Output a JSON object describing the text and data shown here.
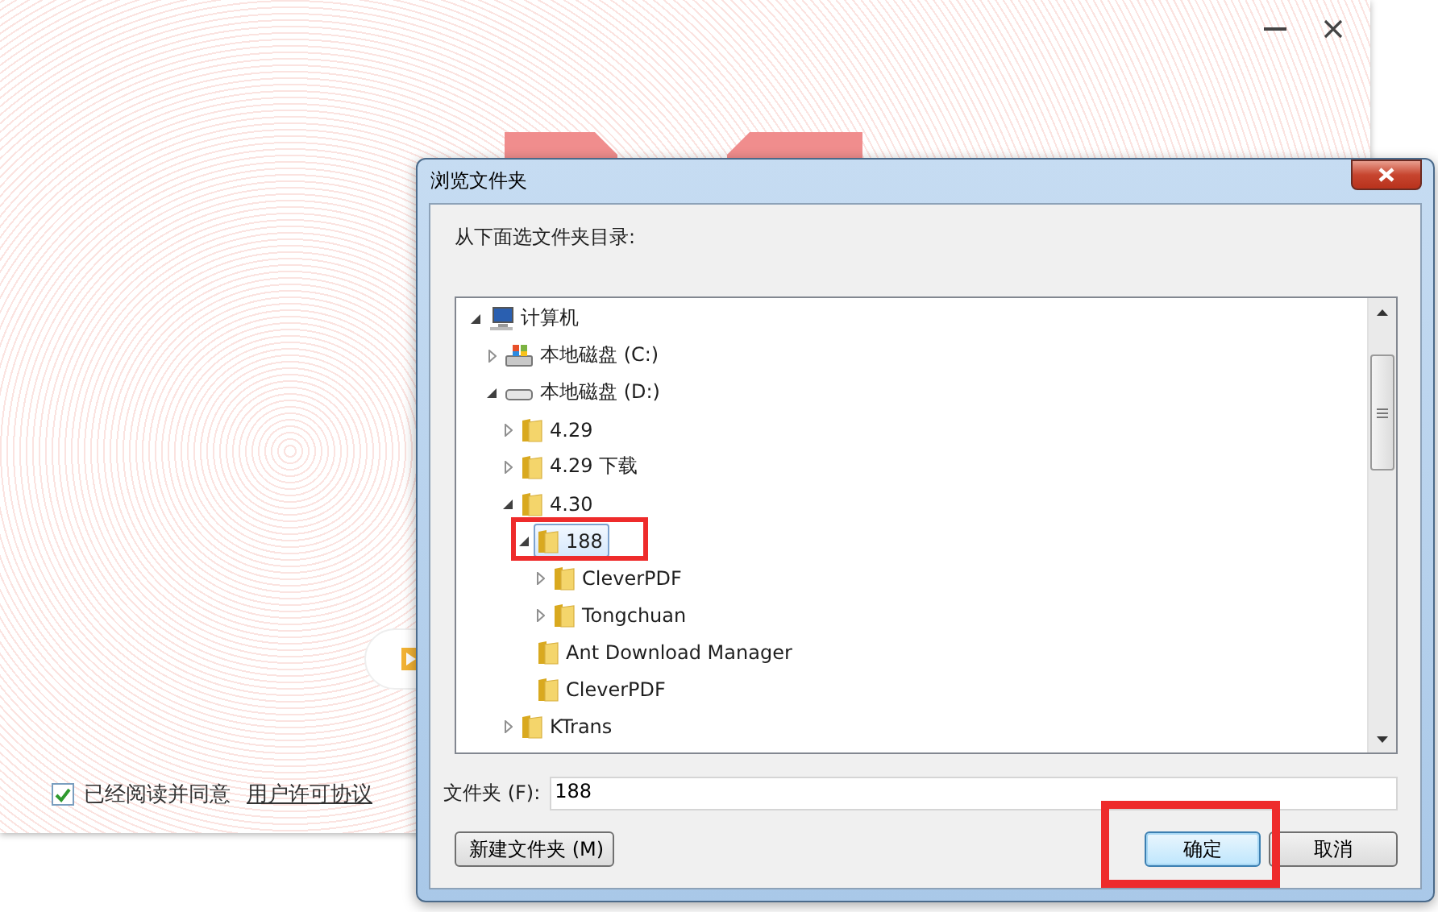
{
  "app": {
    "agree": {
      "checked": true,
      "label": "已经阅读并同意",
      "link": "用户许可协议"
    }
  },
  "dialog": {
    "title": "浏览文件夹",
    "prompt": "从下面选文件夹目录:",
    "tree": [
      {
        "label": "计算机",
        "kind": "computer",
        "expanded": true,
        "selected": false,
        "children": [
          {
            "label": "本地磁盘 (C:)",
            "kind": "system-drive",
            "expanded": false,
            "selected": false
          },
          {
            "label": "本地磁盘 (D:)",
            "kind": "drive",
            "expanded": true,
            "selected": false,
            "children": [
              {
                "label": "4.29",
                "kind": "folder",
                "expanded": false,
                "selected": false
              },
              {
                "label": "4.29 下载",
                "kind": "folder",
                "expanded": false,
                "selected": false
              },
              {
                "label": "4.30",
                "kind": "folder",
                "expanded": true,
                "selected": false,
                "children": [
                  {
                    "label": "188",
                    "kind": "folder",
                    "expanded": true,
                    "selected": true,
                    "children": [
                      {
                        "label": "CleverPDF",
                        "kind": "folder",
                        "expanded": false,
                        "selected": false
                      },
                      {
                        "label": "Tongchuan",
                        "kind": "folder",
                        "expanded": false,
                        "selected": false
                      }
                    ]
                  },
                  {
                    "label": "Ant Download Manager",
                    "kind": "folder",
                    "selected": false
                  },
                  {
                    "label": "CleverPDF",
                    "kind": "folder",
                    "selected": false
                  }
                ]
              },
              {
                "label": "KTrans",
                "kind": "folder",
                "expanded": false,
                "selected": false
              }
            ]
          }
        ]
      }
    ],
    "folder_field": {
      "label": "文件夹 (F):",
      "value": "188"
    },
    "buttons": [
      {
        "label": "新建文件夹 (M)",
        "default": false
      },
      {
        "label": "确定",
        "default": true
      },
      {
        "label": "取消",
        "default": false
      }
    ]
  }
}
